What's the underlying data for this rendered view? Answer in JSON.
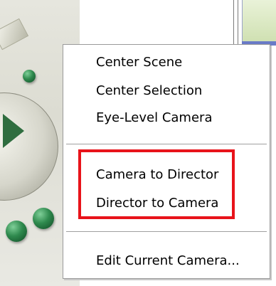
{
  "context_menu": {
    "items": [
      {
        "label": "Center Scene"
      },
      {
        "label": "Center Selection"
      },
      {
        "label": "Eye-Level Camera"
      },
      {
        "label": "Camera to Director"
      },
      {
        "label": "Director to Camera"
      },
      {
        "label": "Edit Current Camera..."
      }
    ]
  },
  "colors": {
    "highlight_border": "#e8131a",
    "menu_background": "#ffffff",
    "separator": "#a0a0a0"
  }
}
